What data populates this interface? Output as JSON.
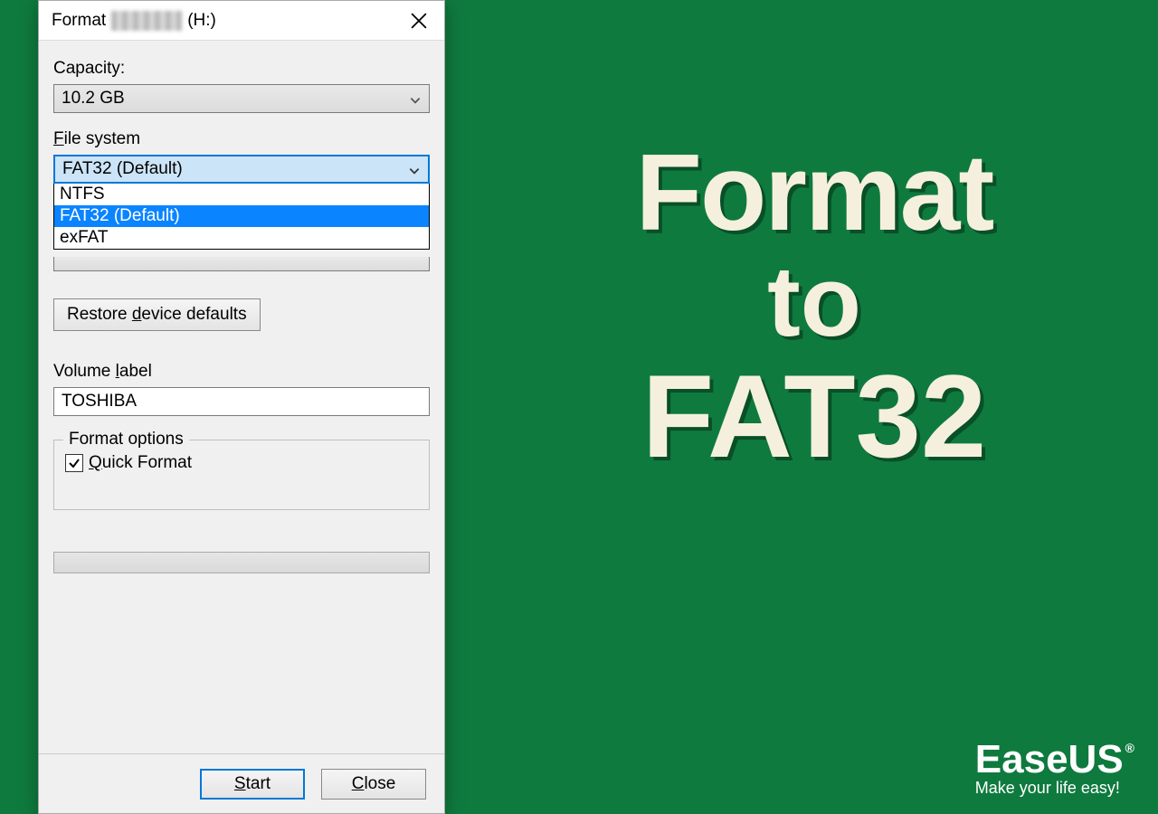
{
  "dialog": {
    "title_prefix": "Format",
    "drive_suffix": "(H:)",
    "capacity_label": "Capacity:",
    "capacity_value": "10.2 GB",
    "filesystem_label": "File system",
    "filesystem_underline_char": "F",
    "filesystem_value": "FAT32 (Default)",
    "filesystem_options": [
      "NTFS",
      "FAT32 (Default)",
      "exFAT"
    ],
    "restore_label_pre": "Restore ",
    "restore_label_u": "d",
    "restore_label_post": "evice defaults",
    "volume_label_pre": "Volume ",
    "volume_label_u": "l",
    "volume_label_post": "abel",
    "volume_value": "TOSHIBA",
    "format_options_legend": "Format options",
    "quick_format_u": "Q",
    "quick_format_post": "uick Format",
    "quick_format_checked": true,
    "start_u": "S",
    "start_post": "tart",
    "close_u": "C",
    "close_post": "lose"
  },
  "headline": {
    "line1": "Format",
    "line2": "to",
    "line3": "FAT32"
  },
  "logo": {
    "brand": "EaseUS",
    "reg": "®",
    "tagline": "Make your life easy!"
  }
}
